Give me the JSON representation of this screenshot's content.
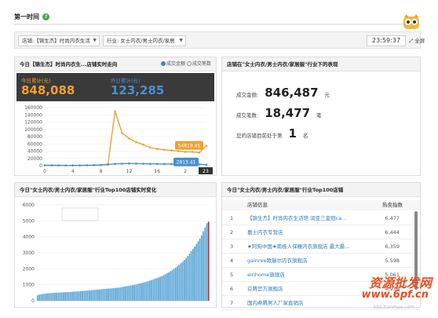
{
  "header": {
    "title": "第一时间",
    "help_icon": "question-circle-icon"
  },
  "filters": {
    "shop_label": "店铺:【锦生杰】时尚内衣生活",
    "industry_label": "行业: 女士内衣/男士内衣/家居",
    "clock": "23:59:37",
    "fullscreen_label": "全屏"
  },
  "panel_trend": {
    "title": "今日【锦生杰】时尚内衣生...店铺实时走向",
    "radio_amount": "成交金额",
    "radio_count": "成交笔数",
    "today_label": "今日累计(元)",
    "today_value": "848,088",
    "yesterday_label": "昨日累计(元)",
    "yesterday_value": "123,285",
    "tooltip_orange": "54819.45",
    "tooltip_blue": "2813.41",
    "hour_marker": "23",
    "accent_orange": "#f0a030",
    "accent_blue": "#4a8fd0"
  },
  "panel_stats": {
    "title": "店铺在\"女士内衣/男士内衣/家居服\"行业下的表现",
    "amount_label": "成交金额:",
    "amount_value": "846,487",
    "amount_unit": "元",
    "count_label": "成交笔数:",
    "count_value": "18,477",
    "count_unit": "笔",
    "rank_label": "您的店铺目前处于第",
    "rank_value": "1",
    "rank_unit": "名"
  },
  "panel_top100_chart": {
    "title": "今日\"女士内衣/男士内衣/家居服\"行业Top100店铺实时变化"
  },
  "panel_top100_list": {
    "title": "今日\"女士内衣/男士内衣/家居服\"行业Top100店铺",
    "col_name": "店铺信息",
    "col_index": "热卖指数",
    "rows": [
      {
        "rank": "1",
        "name": "【锦生杰】时尚内衣生活馆 润亚三金冠ca...",
        "index": "6,477"
      },
      {
        "rank": "2",
        "name": "嘉士内衣专营店",
        "index": "6,444"
      },
      {
        "rank": "3",
        "name": "★阿狗中国★南极人保暖内衣旗舰店 最大最...",
        "index": "6,359"
      },
      {
        "rank": "4",
        "name": "gainree歌瑞尔内衣旗舰店",
        "index": "5,598"
      },
      {
        "rank": "5",
        "name": "einhome旗舰店",
        "index": "5,061"
      },
      {
        "rank": "6",
        "name": "芬腾官方旗舰店",
        "index": "4,936"
      },
      {
        "rank": "7",
        "name": "国内希腾男人厂家直销店",
        "index": ""
      }
    ]
  },
  "watermark": {
    "line1": "资源批发网",
    "line2": "www.6pf.cn",
    "line3": "bbs.tianmao.com"
  },
  "chart_data": [
    {
      "type": "line",
      "title": "",
      "x": [
        0,
        1,
        2,
        3,
        4,
        5,
        6,
        7,
        8,
        9,
        10,
        11,
        12,
        13,
        14,
        15,
        16,
        17,
        18,
        19,
        20,
        21,
        22,
        23
      ],
      "x_ticks": [
        "0",
        "4",
        "8",
        "12",
        "16",
        "2",
        "23"
      ],
      "y_ticks": [
        "0",
        "20000",
        "40000",
        "60000",
        "80000",
        "100000",
        "120000",
        "140000",
        "160000"
      ],
      "ylim": [
        0,
        160000
      ],
      "series": [
        {
          "name": "",
          "color": "#f0a030",
          "values": [
            1000,
            800,
            600,
            600,
            600,
            700,
            900,
            1200,
            1500,
            5000,
            150000,
            90000,
            75000,
            65000,
            58000,
            50000,
            46000,
            44000,
            42000,
            40000,
            38000,
            38000,
            36000,
            54819
          ]
        },
        {
          "name": "",
          "color": "#4a8fd0",
          "values": [
            1200,
            900,
            800,
            700,
            700,
            800,
            1000,
            1500,
            2000,
            3000,
            5000,
            5500,
            6000,
            5600,
            5400,
            5000,
            4800,
            4600,
            4400,
            4200,
            4000,
            3800,
            3500,
            2813
          ]
        }
      ]
    },
    {
      "type": "bar",
      "title": "",
      "y_ticks": [
        "0",
        "1000",
        "2000",
        "3000",
        "4000",
        "5000",
        "6000"
      ],
      "ylim": [
        0,
        6000
      ],
      "values": [
        350,
        380,
        400,
        420,
        440,
        450,
        460,
        470,
        480,
        490,
        500,
        505,
        510,
        515,
        520,
        525,
        530,
        540,
        545,
        550,
        560,
        570,
        580,
        585,
        590,
        600,
        610,
        620,
        630,
        640,
        650,
        660,
        670,
        680,
        690,
        700,
        710,
        720,
        730,
        740,
        750,
        760,
        770,
        780,
        790,
        800,
        810,
        820,
        840,
        860,
        880,
        900,
        920,
        940,
        960,
        980,
        1000,
        1020,
        1050,
        1080,
        1100,
        1130,
        1160,
        1190,
        1220,
        1260,
        1300,
        1340,
        1380,
        1420,
        1460,
        1500,
        1550,
        1600,
        1660,
        1720,
        1780,
        1850,
        1920,
        2000,
        2080,
        2160,
        2250,
        2350,
        2450,
        2560,
        2680,
        2800,
        2950,
        3100,
        3250,
        3400,
        3560,
        3720,
        3900,
        4100,
        4350,
        4600,
        4850,
        4950
      ]
    }
  ]
}
